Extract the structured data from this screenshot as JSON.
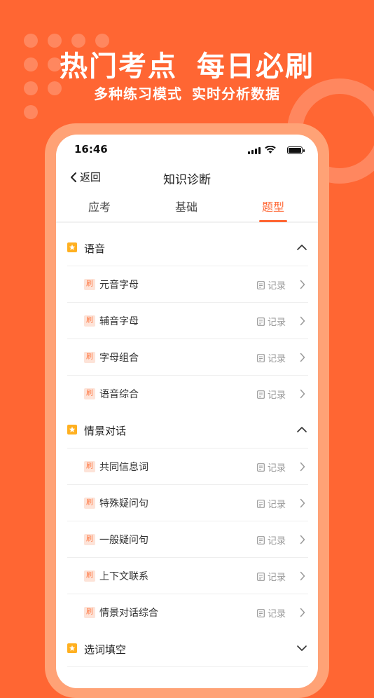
{
  "banner": {
    "headline_left": "热门考点",
    "headline_right": "每日必刷",
    "subline_left": "多种练习模式",
    "subline_right": "实时分析数据"
  },
  "status_bar": {
    "time": "16:46"
  },
  "nav": {
    "back_label": "返回",
    "title": "知识诊断"
  },
  "tabs": [
    {
      "label": "应考",
      "active": false
    },
    {
      "label": "基础",
      "active": false
    },
    {
      "label": "题型",
      "active": true
    }
  ],
  "tag_label": "刷",
  "record_label": "记录",
  "sections": [
    {
      "label": "语音",
      "expanded": true
    },
    {
      "label": "情景对话",
      "expanded": true
    },
    {
      "label": "选词填空",
      "expanded": false
    }
  ],
  "items": {
    "voice": [
      "元音字母",
      "辅音字母",
      "字母组合",
      "语音综合"
    ],
    "dialogue": [
      "共同信息词",
      "特殊疑问句",
      "一般疑问句",
      "上下文联系",
      "情景对话综合"
    ]
  },
  "colors": {
    "brand": "#ff6633",
    "star": "#ffb020",
    "tag_bg": "#fde3d8"
  }
}
